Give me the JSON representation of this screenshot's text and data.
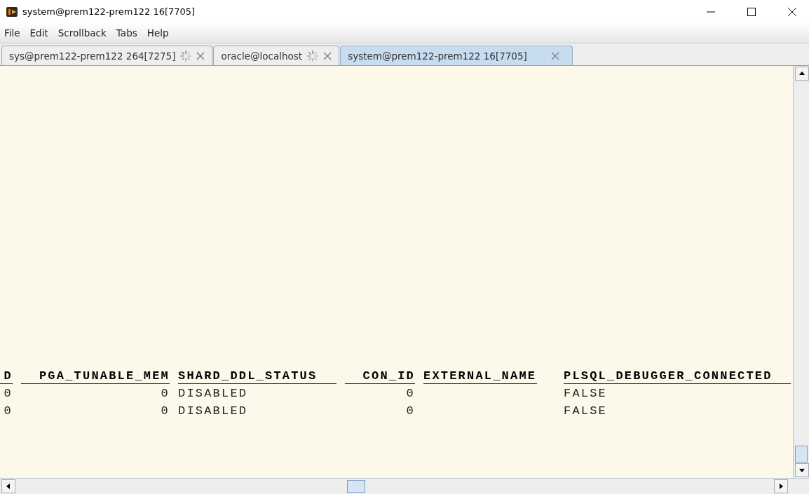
{
  "window": {
    "title": "system@prem122-prem122 16[7705]"
  },
  "menu": [
    "File",
    "Edit",
    "Scrollback",
    "Tabs",
    "Help"
  ],
  "tabs": [
    {
      "label": "sys@prem122-prem122 264[7275]",
      "loading": true,
      "selected": false
    },
    {
      "label": "oracle@localhost",
      "loading": true,
      "selected": false
    },
    {
      "label": "system@prem122-prem122 16[7705]",
      "loading": false,
      "selected": true
    }
  ],
  "table": {
    "columns": [
      {
        "label": "D",
        "kind": "number"
      },
      {
        "label": "PGA_TUNABLE_MEM",
        "kind": "number"
      },
      {
        "label": "SHARD_DDL_STATUS",
        "kind": "text"
      },
      {
        "label": "CON_ID",
        "kind": "number"
      },
      {
        "label": "EXTERNAL_NAME",
        "kind": "text"
      },
      {
        "label": "PLSQL_DEBUGGER_CONNECTED",
        "kind": "text"
      }
    ],
    "rows": [
      [
        "0",
        "0",
        "DISABLED",
        "0",
        "",
        "FALSE"
      ],
      [
        "0",
        "0",
        "DISABLED",
        "0",
        "",
        "FALSE"
      ]
    ]
  }
}
